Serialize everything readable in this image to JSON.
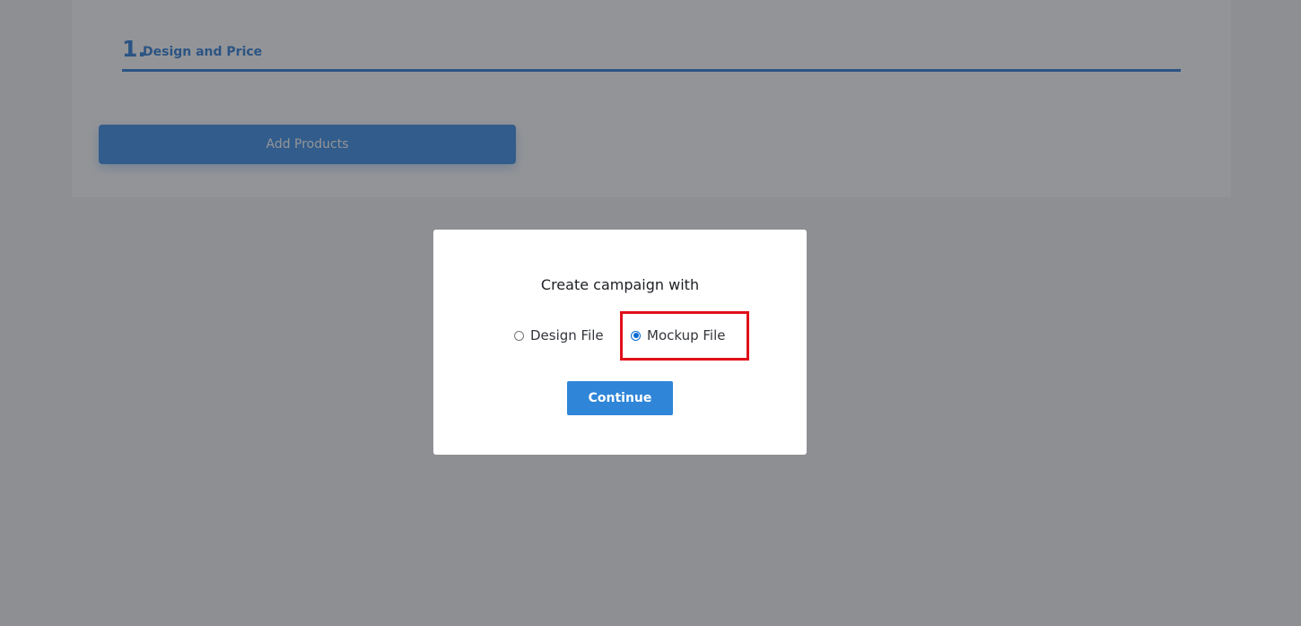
{
  "step": {
    "number": "1.",
    "title": "Design and Price"
  },
  "add_products_label": "Add Products",
  "modal": {
    "title": "Create campaign with",
    "options": [
      {
        "label": "Design File",
        "checked": false
      },
      {
        "label": "Mockup File",
        "checked": true
      }
    ],
    "continue_label": "Continue"
  },
  "colors": {
    "accent": "#2f7fd8",
    "button": "#3a8ee6",
    "highlight": "#e0101a",
    "overlay": "rgba(40,42,48,0.5)"
  }
}
